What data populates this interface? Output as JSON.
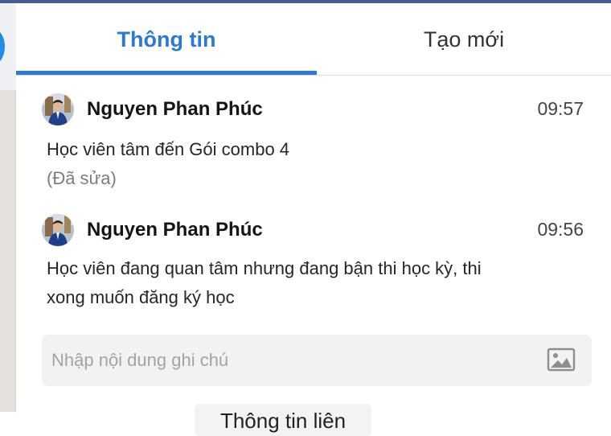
{
  "tabs": [
    {
      "label": "Thông tin",
      "active": true
    },
    {
      "label": "Tạo mới",
      "active": false
    }
  ],
  "notes": [
    {
      "author": "Nguyen Phan Phúc",
      "time": "09:57",
      "text": "Học viên tâm đến Gói combo 4",
      "edited": "(Đã sửa)"
    },
    {
      "author": "Nguyen Phan Phúc",
      "time": "09:56",
      "text_lines": [
        "Học viên đang quan tâm nhưng đang bận thi học kỳ, thi",
        "xong muốn đăng ký học"
      ]
    }
  ],
  "note_input": {
    "placeholder": "Nhập nội dung ghi chú",
    "icon": "image-icon"
  },
  "bottom_button": {
    "label": "Thông tin liên"
  },
  "colors": {
    "accent": "#2b79d0",
    "topbar": "#4a5a92",
    "input_bg": "#f2f2f2"
  }
}
